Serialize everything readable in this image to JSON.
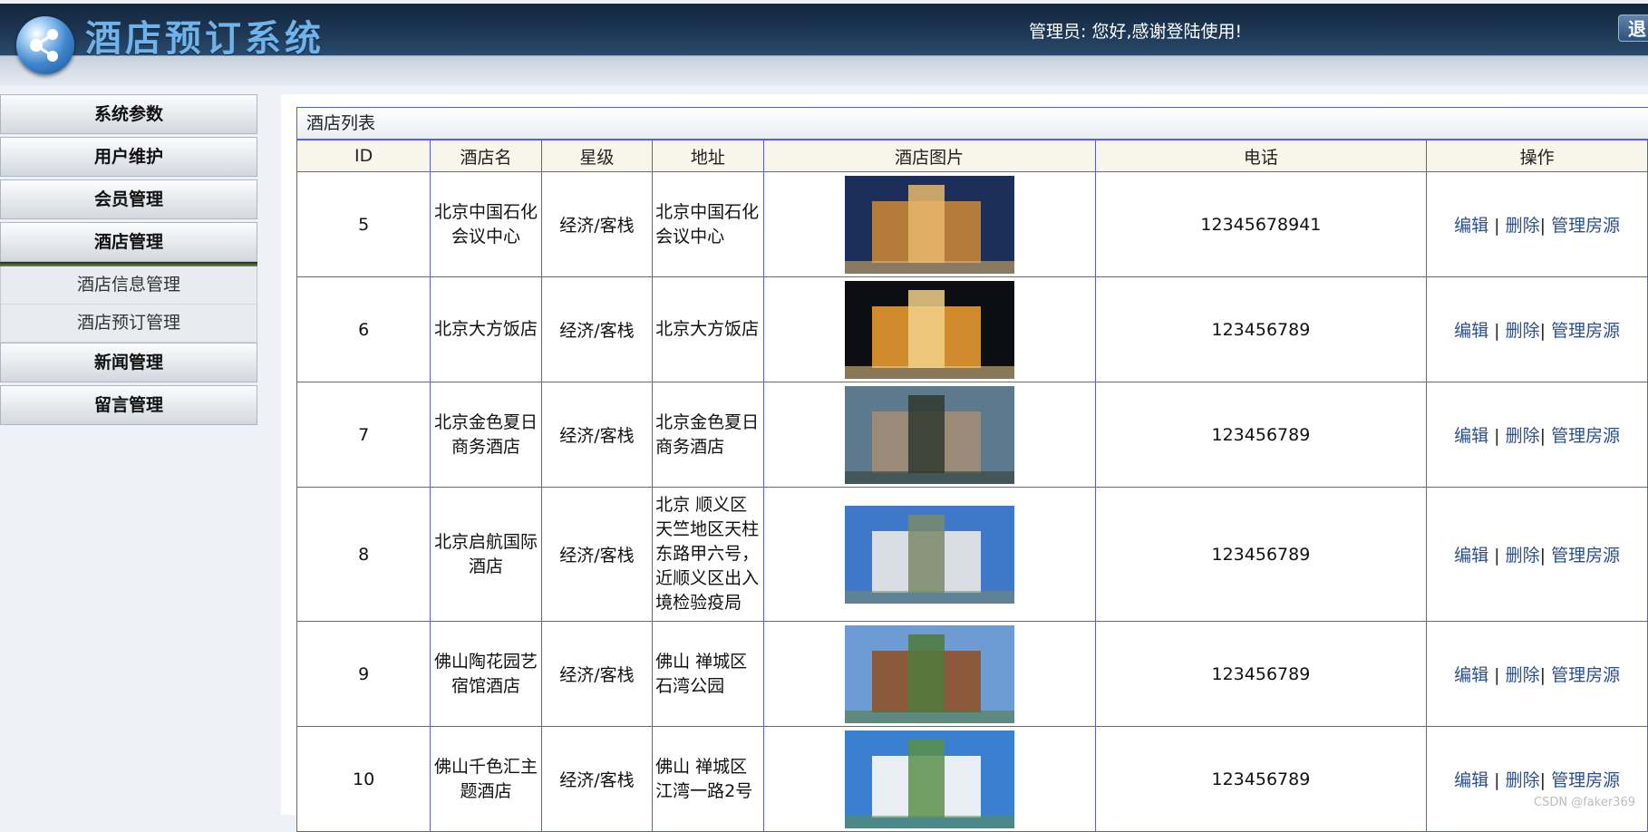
{
  "header": {
    "system_title": "酒店预订系统",
    "welcome": "管理员:  您好,感谢登陆使用!",
    "logout_label": "退出"
  },
  "sidebar": {
    "menus": [
      {
        "label": "系统参数"
      },
      {
        "label": "用户维护"
      },
      {
        "label": "会员管理"
      },
      {
        "label": "酒店管理"
      }
    ],
    "submenu": [
      {
        "label": "酒店信息管理"
      },
      {
        "label": "酒店预订管理"
      }
    ],
    "menus_after": [
      {
        "label": "新闻管理"
      },
      {
        "label": "留言管理"
      }
    ]
  },
  "panel": {
    "title": "酒店列表"
  },
  "table": {
    "columns": [
      "ID",
      "酒店名",
      "星级",
      "地址",
      "酒店图片",
      "电话",
      "操作"
    ],
    "rows": [
      {
        "id": "5",
        "name": "北京中国石化会议中心",
        "star": "经济/客栈",
        "address": "北京中国石化会议中心",
        "phone": "12345678941",
        "image_icon": "hotel-photo-icon"
      },
      {
        "id": "6",
        "name": "北京大方饭店",
        "star": "经济/客栈",
        "address": "北京大方饭店",
        "phone": "123456789",
        "image_icon": "hotel-photo-icon"
      },
      {
        "id": "7",
        "name": "北京金色夏日商务酒店",
        "star": "经济/客栈",
        "address": "北京金色夏日商务酒店",
        "phone": "123456789",
        "image_icon": "hotel-photo-icon"
      },
      {
        "id": "8",
        "name": "北京启航国际酒店",
        "star": "经济/客栈",
        "address": "北京 顺义区天竺地区天柱东路甲六号，近顺义区出入境检验疫局",
        "phone": "123456789",
        "image_icon": "hotel-photo-icon"
      },
      {
        "id": "9",
        "name": "佛山陶花园艺宿馆酒店",
        "star": "经济/客栈",
        "address": "佛山 禅城区石湾公园",
        "phone": "123456789",
        "image_icon": "hotel-photo-icon"
      },
      {
        "id": "10",
        "name": "佛山千色汇主题酒店",
        "star": "经济/客栈",
        "address": "佛山 禅城区江湾一路2号",
        "phone": "123456789",
        "image_icon": "hotel-photo-icon"
      }
    ],
    "ops": {
      "edit": "编辑",
      "delete": "删除",
      "manage_rooms": "管理房源",
      "sep1": " | ",
      "sep2": "| "
    }
  },
  "watermark": "CSDN @faker369",
  "colors": {
    "header_bg": "#1d3754",
    "table_border": "#5a5ae8",
    "link": "#2a4f8a"
  }
}
